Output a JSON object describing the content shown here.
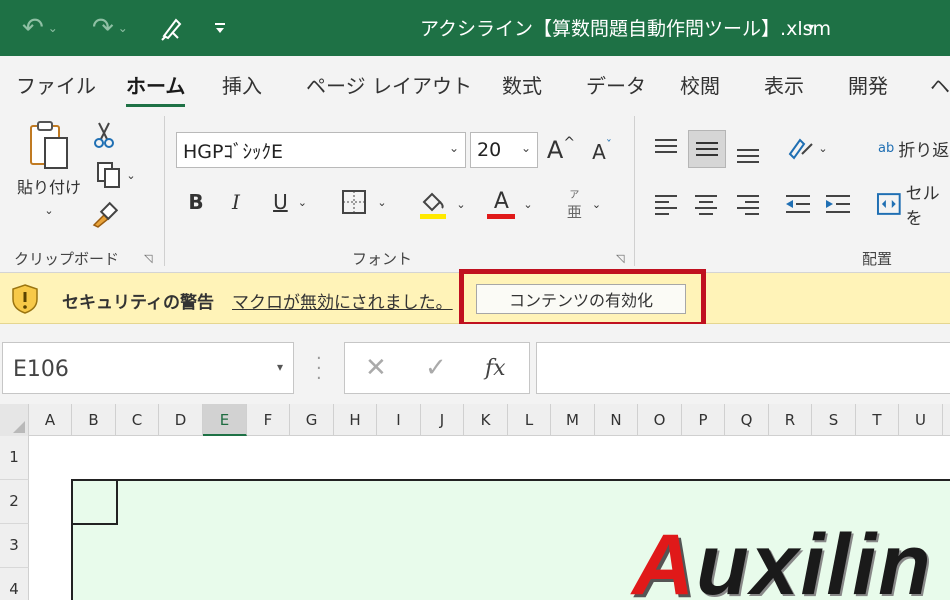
{
  "titlebar": {
    "title": "アクシライン【算数問題自動作問ツール】.xlsm",
    "caret": "▾"
  },
  "ribbon_tabs": [
    "ファイル",
    "ホーム",
    "挿入",
    "ページ レイアウト",
    "数式",
    "データ",
    "校閲",
    "表示",
    "開発",
    "ヘ"
  ],
  "active_tab": "ホーム",
  "clipboard": {
    "paste_label": "貼り付け",
    "group_label": "クリップボード"
  },
  "font": {
    "name": "HGPｺﾞｼｯｸE",
    "size": "20",
    "bold": "B",
    "italic": "I",
    "underline": "U",
    "grow": "A",
    "shrink": "A",
    "font_color_glyph": "A",
    "phonetic_glyph": "亜",
    "phonetic_top": "ア",
    "group_label": "フォント"
  },
  "alignment": {
    "wrap_label": "折り返",
    "merge_label": "セルを",
    "wrap_glyph": "ab",
    "group_label": "配置"
  },
  "colors": {
    "excel_green": "#1e7145",
    "highlight_red": "#c0101f",
    "fill_yellow": "#ffe900",
    "font_red": "#e01919",
    "security_bg": "#fff3b8"
  },
  "security": {
    "title": "セキュリティの警告",
    "message": "マクロが無効にされました。",
    "enable_button": "コンテンツの有効化"
  },
  "formula_bar": {
    "name_box": "E106",
    "cancel": "✕",
    "enter": "✓",
    "fx": "fx",
    "value": ""
  },
  "columns": [
    "A",
    "B",
    "C",
    "D",
    "E",
    "F",
    "G",
    "H",
    "I",
    "J",
    "K",
    "L",
    "M",
    "N",
    "O",
    "P",
    "Q",
    "R",
    "S",
    "T",
    "U"
  ],
  "rows": [
    "1",
    "2",
    "3",
    "4"
  ],
  "selected_cell": "E106",
  "sheet_logo": {
    "first": "A",
    "rest": "uxilin"
  }
}
